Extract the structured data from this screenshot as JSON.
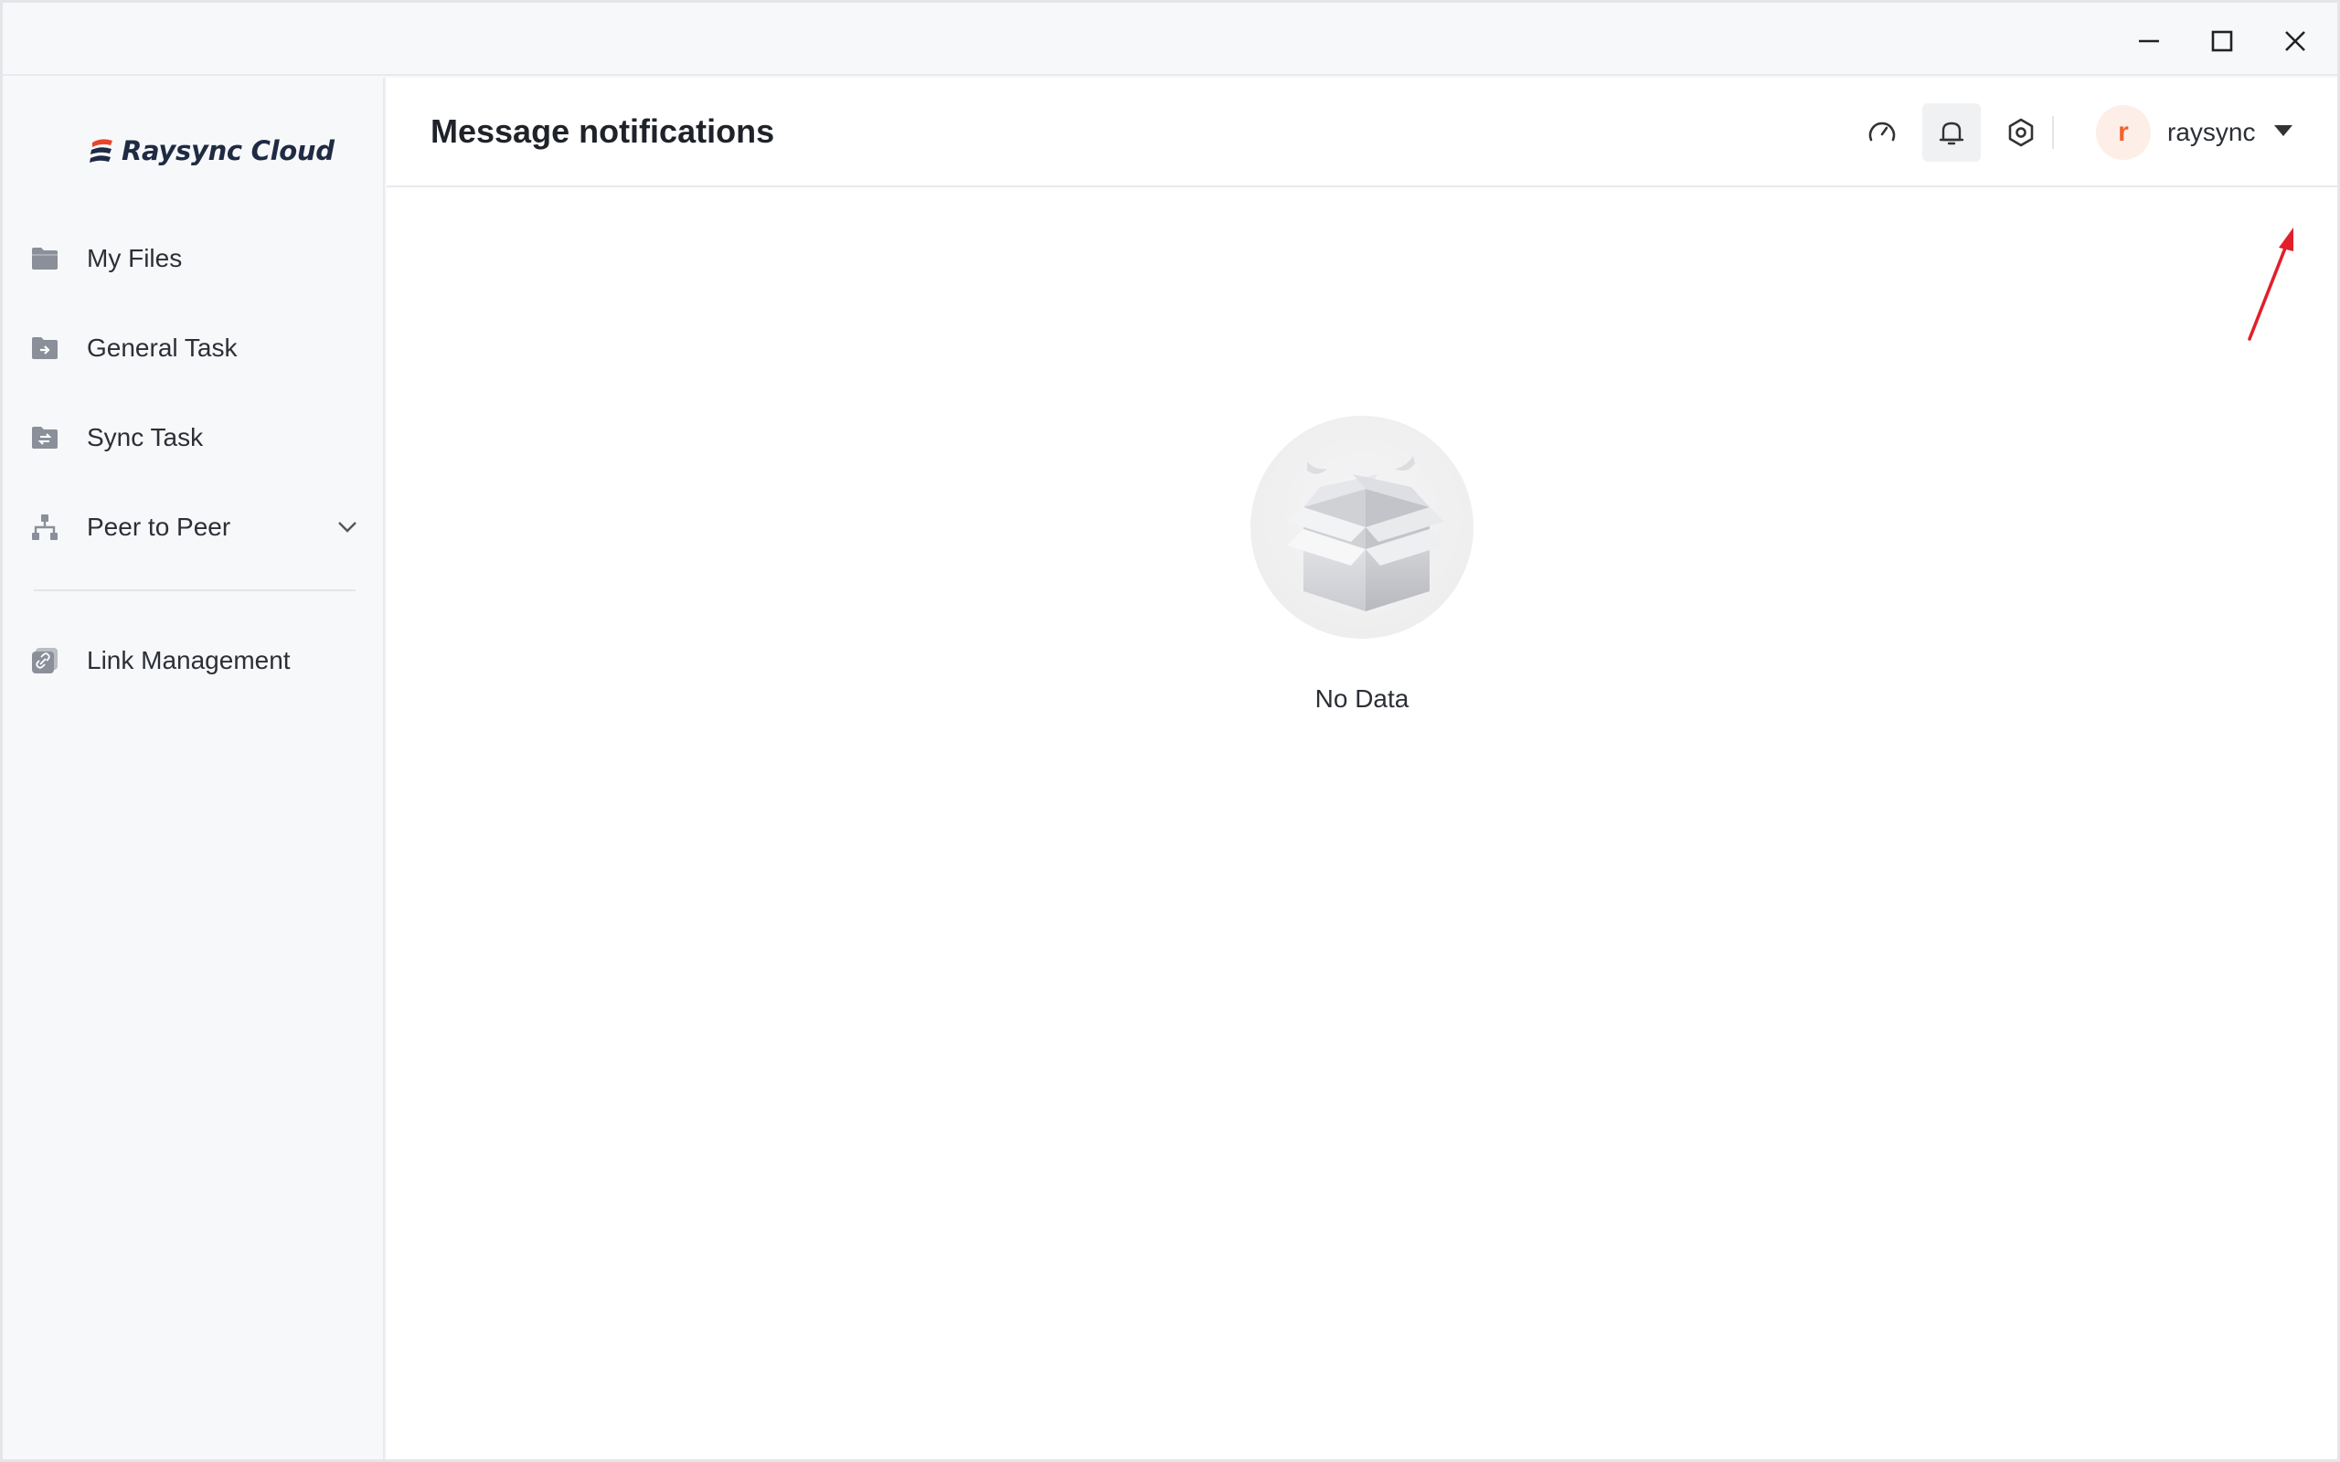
{
  "app": {
    "brand": "Raysync Cloud",
    "colors": {
      "accent": "#f0642d",
      "arrow": "#e0202a",
      "icon": "#8a8f99"
    }
  },
  "window_controls": {
    "minimize": "minimize-icon",
    "maximize": "maximize-icon",
    "close": "close-icon"
  },
  "sidebar": {
    "items": [
      {
        "label": "My Files",
        "icon": "folder-icon"
      },
      {
        "label": "General Task",
        "icon": "folder-arrow-icon"
      },
      {
        "label": "Sync Task",
        "icon": "folder-sync-icon"
      },
      {
        "label": "Peer to Peer",
        "icon": "network-icon",
        "expandable": true
      },
      {
        "label": "Link Management",
        "icon": "link-icon"
      }
    ]
  },
  "header": {
    "title": "Message notifications",
    "icons": [
      "speedometer-icon",
      "bell-icon",
      "settings-hexagon-icon"
    ],
    "active_icon": "bell-icon"
  },
  "user": {
    "avatar_letter": "r",
    "name": "raysync"
  },
  "empty_state": {
    "text": "No Data",
    "icon": "empty-box-icon"
  }
}
